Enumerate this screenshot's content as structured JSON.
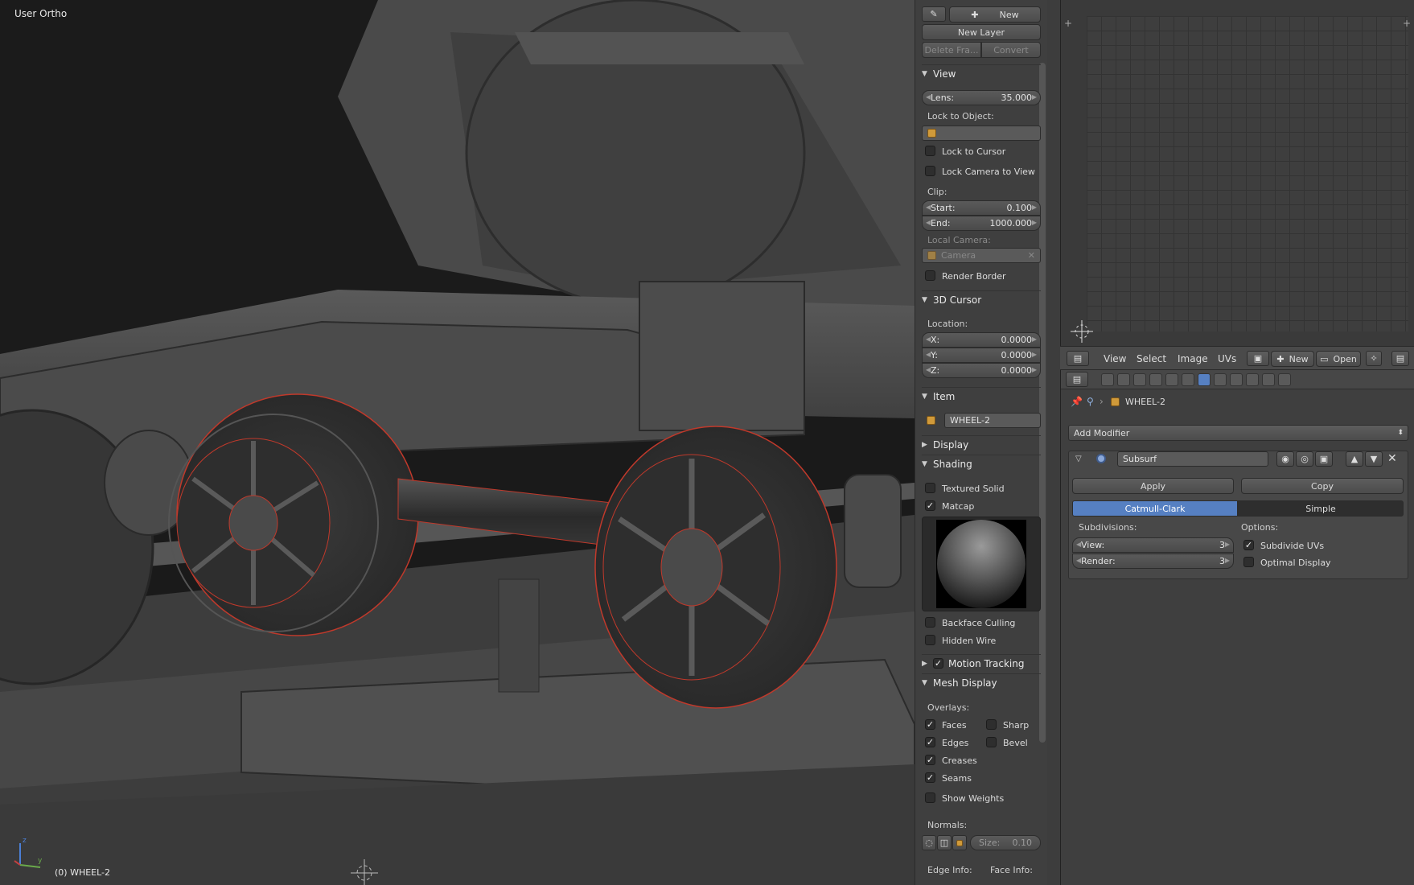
{
  "viewport": {
    "title": "User Ortho",
    "object_label": "(0) WHEEL-2",
    "axis_x": "x",
    "axis_y": "y",
    "axis_z": "z"
  },
  "npanel": {
    "grease": {
      "new": "New",
      "new_layer": "New Layer",
      "delete_frame": "Delete Fra...",
      "convert": "Convert"
    },
    "view": {
      "header": "View",
      "lens_label": "Lens:",
      "lens_value": "35.000",
      "lock_to_object": "Lock to Object:",
      "lock_to_cursor": "Lock to Cursor",
      "lock_camera": "Lock Camera to View",
      "clip": "Clip:",
      "start_label": "Start:",
      "start_value": "0.100",
      "end_label": "End:",
      "end_value": "1000.000",
      "local_camera": "Local Camera:",
      "camera": "Camera",
      "render_border": "Render Border"
    },
    "cursor": {
      "header": "3D Cursor",
      "location": "Location:",
      "x_label": "X:",
      "x_value": "0.0000",
      "y_label": "Y:",
      "y_value": "0.0000",
      "z_label": "Z:",
      "z_value": "0.0000"
    },
    "item": {
      "header": "Item",
      "name": "WHEEL-2"
    },
    "display": {
      "header": "Display"
    },
    "shading": {
      "header": "Shading",
      "textured_solid": "Textured Solid",
      "matcap": "Matcap",
      "backface_culling": "Backface Culling",
      "hidden_wire": "Hidden Wire"
    },
    "motion_tracking": {
      "header": "Motion Tracking"
    },
    "mesh_display": {
      "header": "Mesh Display",
      "overlays": "Overlays:",
      "faces": "Faces",
      "sharp": "Sharp",
      "edges": "Edges",
      "bevel": "Bevel",
      "creases": "Creases",
      "seams": "Seams",
      "show_weights": "Show Weights",
      "normals": "Normals:",
      "size_label": "Size:",
      "size_value": "0.10",
      "edge_info": "Edge Info:",
      "face_info": "Face Info:"
    }
  },
  "uv_editor": {
    "menus": [
      "View",
      "Select",
      "Image",
      "UVs"
    ],
    "new": "New",
    "open": "Open"
  },
  "properties": {
    "object_name": "WHEEL-2",
    "add_modifier": "Add Modifier",
    "modifier": {
      "name": "Subsurf",
      "apply": "Apply",
      "copy": "Copy",
      "catmull": "Catmull-Clark",
      "simple": "Simple",
      "subdivisions": "Subdivisions:",
      "options": "Options:",
      "view_label": "View:",
      "view_value": "3",
      "render_label": "Render:",
      "render_value": "3",
      "subdivide_uvs": "Subdivide UVs",
      "optimal_display": "Optimal Display"
    }
  },
  "colors": {
    "accent": "#5680c2",
    "wire": "#c0392b",
    "object_icon": "#d09a3a"
  }
}
